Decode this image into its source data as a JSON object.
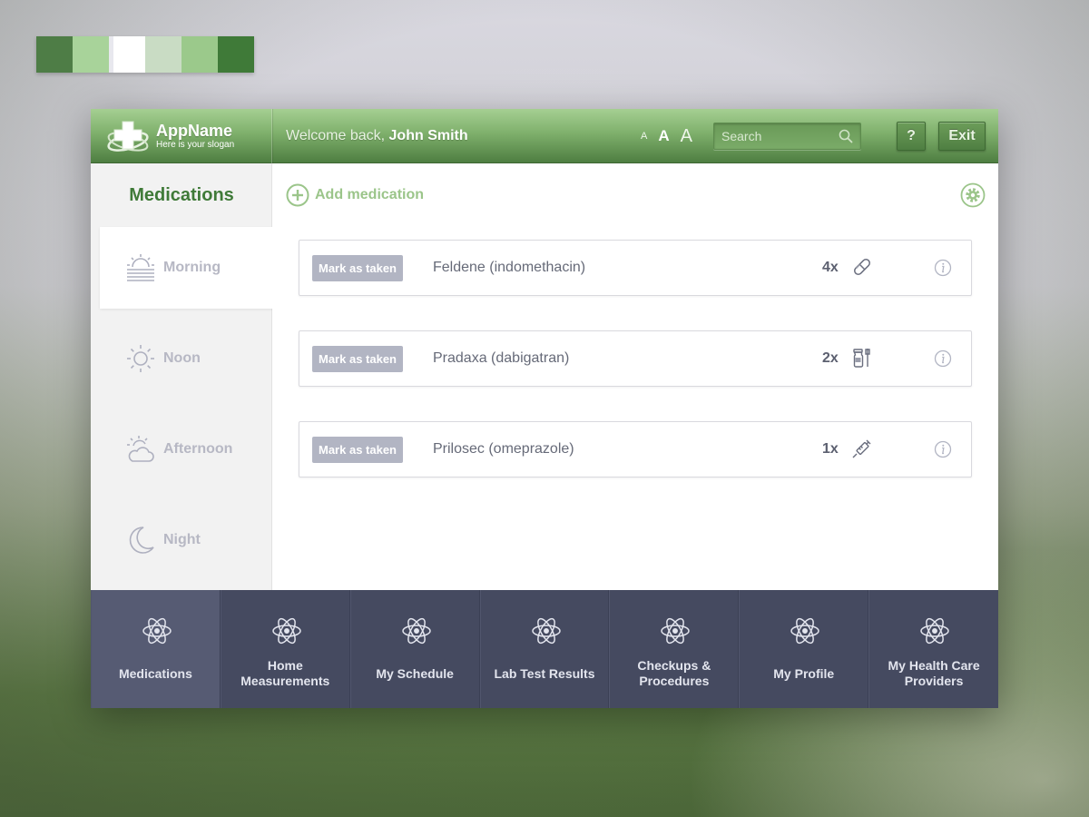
{
  "palette": [
    "#4e7d46",
    "#a8d39a",
    "#ffffff",
    "#c9dcc4",
    "#9bc98b",
    "#3f7a38"
  ],
  "header": {
    "app_name": "AppName",
    "slogan": "Here is your slogan",
    "welcome_prefix": "Welcome back,",
    "user_name": "John Smith",
    "font_small": "A",
    "font_medium": "A",
    "font_large": "A",
    "search_placeholder": "Search",
    "help_label": "?",
    "exit_label": "Exit"
  },
  "sidebar": {
    "title": "Medications",
    "slots": [
      {
        "label": "Morning",
        "icon": "sunrise-icon",
        "active": true
      },
      {
        "label": "Noon",
        "icon": "sun-icon",
        "active": false
      },
      {
        "label": "Afternoon",
        "icon": "cloudy-sun-icon",
        "active": false
      },
      {
        "label": "Night",
        "icon": "moon-icon",
        "active": false
      }
    ]
  },
  "main": {
    "add_label": "Add medication",
    "medications": [
      {
        "mark_label": "Mark as taken",
        "name": "Feldene (indomethacin)",
        "count": "4x",
        "type_icon": "capsule-icon"
      },
      {
        "mark_label": "Mark as taken",
        "name": "Pradaxa (dabigatran)",
        "count": "2x",
        "type_icon": "liquid-bottle-icon"
      },
      {
        "mark_label": "Mark as taken",
        "name": "Prilosec (omeprazole)",
        "count": "1x",
        "type_icon": "syringe-icon"
      }
    ]
  },
  "nav": {
    "items": [
      {
        "label": "Medications",
        "active": true
      },
      {
        "label": "Home Measurements",
        "active": false
      },
      {
        "label": "My Schedule",
        "active": false
      },
      {
        "label": "Lab Test Results",
        "active": false
      },
      {
        "label": "Checkups & Procedures",
        "active": false
      },
      {
        "label": "My Profile",
        "active": false
      },
      {
        "label": "My Health Care Providers",
        "active": false
      }
    ]
  },
  "colors": {
    "accent_green": "#3f7a38",
    "light_green": "#9bc58a",
    "nav_bg": "#454a60",
    "button_gray": "#b2b5c3"
  }
}
